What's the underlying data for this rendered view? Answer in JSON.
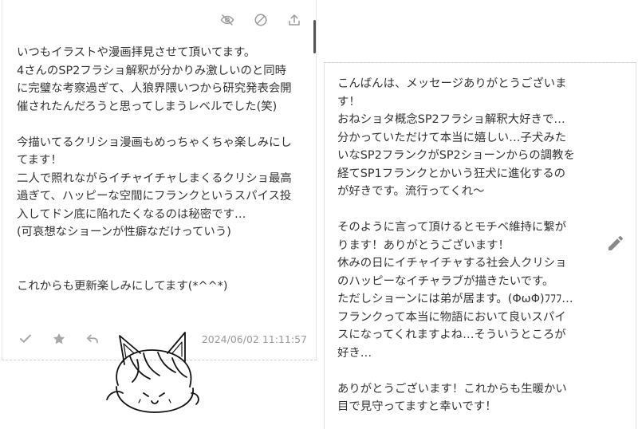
{
  "colors": {
    "text": "#333333",
    "icon": "#9a9a9a",
    "timestamp": "#9a9a9a",
    "border": "#e6e6e6"
  },
  "left_card": {
    "icons": [
      "eye-slash-icon",
      "block-icon",
      "share-icon"
    ],
    "message_paragraphs": [
      "いつもイラストや漫画拝見させて頂いてます。",
      "4さんのSP2フラショ解釈が分かりみ激しいのと同時",
      "に完璧な考察過ぎて、人狼界隈いつから研究発表会開",
      "催されたんだろうと思ってしまうレベルでした(笑)",
      "",
      "今描いてるクリショ漫画もめっちゃくちゃ楽しみにし",
      "てます！",
      "二人で照れながらイチャイチャしまくるクリショ最高",
      "過ぎて、ハッピーな空間にフランクというスパイス投",
      "入してドン底に陥れたくなるのは秘密です…",
      "(可哀想なショーンが性癖なだけっていう)",
      "",
      "",
      "これからも更新楽しみにしてます(*^^*)"
    ],
    "actions": [
      "check-icon",
      "star-icon",
      "reply-icon"
    ],
    "timestamp": "2024/06/02 11:11:57"
  },
  "right_card": {
    "reply_lines": [
      "こんばんは、メッセージありがとうございま",
      "す！",
      "おねショタ概念SP2フラショ解釈大好きで…",
      "分かっていただけて本当に嬉しい…子犬みた",
      "いなSP2フランクがSP2ショーンからの調教を",
      "経てSP1フランクとかいう狂犬に進化するの",
      "が好きです。流行ってくれ〜",
      "",
      "そのように言って頂けるとモチベ維持に繋が",
      "ります！ありがとうございます！",
      "休みの日にイチャイチャする社会人クリショ",
      "のハッピーなイチャラブが描きたいです。",
      "ただしショーンには弟が居ます。(ΦωΦ)ﾌﾌﾌ…",
      "フランクって本当に物語において良いスパイ",
      "スになってくれますよね…そういうところが",
      "好き…",
      "",
      "ありがとうございます！これからも生暖かい",
      "目で見守ってますと幸いです！"
    ],
    "edit_icon": "pencil-icon"
  },
  "mascot_icon": "fox-girl-mascot-icon"
}
